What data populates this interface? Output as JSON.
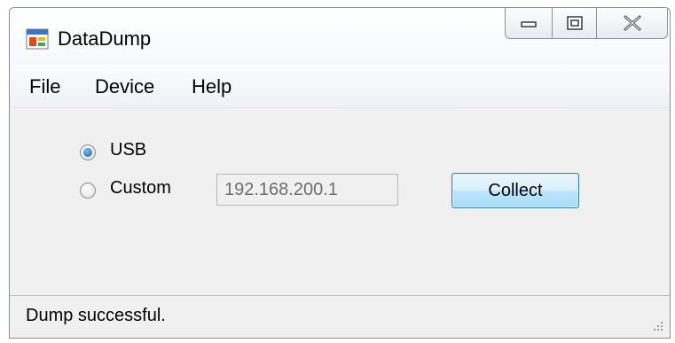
{
  "window": {
    "title": "DataDump",
    "app_icon": "app-window-icon",
    "caption_buttons": {
      "minimize_icon": "minimize-icon",
      "maximize_icon": "maximize-icon",
      "close_icon": "close-icon"
    }
  },
  "menu": {
    "items": [
      {
        "label": "File"
      },
      {
        "label": "Device"
      },
      {
        "label": "Help"
      }
    ]
  },
  "connection": {
    "options": [
      {
        "label": "USB",
        "checked": true
      },
      {
        "label": "Custom",
        "checked": false
      }
    ],
    "ip_address": "192.168.200.1"
  },
  "actions": {
    "collect_label": "Collect"
  },
  "status": {
    "text": "Dump successful."
  },
  "colors": {
    "accent": "#3c7fb1",
    "window_bg": "#f0f0f0"
  }
}
